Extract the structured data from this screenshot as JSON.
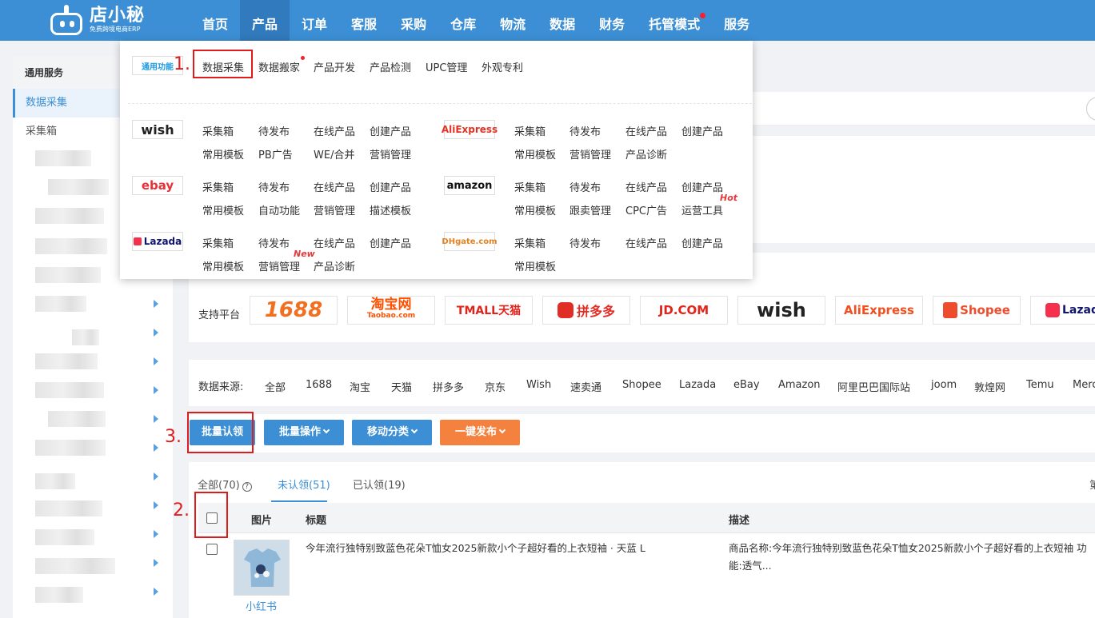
{
  "topbar": {
    "logo_title": "店小秘",
    "logo_sub": "免费跨境电商ERP",
    "nav": [
      "首页",
      "产品",
      "订单",
      "客服",
      "采购",
      "仓库",
      "物流",
      "数据",
      "财务",
      "托管模式",
      "服务"
    ]
  },
  "sidebar": {
    "section_title": "通用服务",
    "items": [
      "数据采集",
      "采集箱"
    ]
  },
  "dropdown": {
    "general_logo": "通用功能",
    "general_links": [
      "数据采集",
      "数据搬家",
      "产品开发",
      "产品检测",
      "UPC管理",
      "外观专利"
    ],
    "platforms": [
      {
        "logo": "wish",
        "links": [
          "采集箱",
          "待发布",
          "在线产品",
          "创建产品",
          "常用模板",
          "PB广告",
          "WE/合并",
          "营销管理"
        ]
      },
      {
        "logo": "AliExpress",
        "links": [
          "采集箱",
          "待发布",
          "在线产品",
          "创建产品",
          "常用模板",
          "营销管理",
          "产品诊断"
        ]
      },
      {
        "logo": "ebay",
        "links": [
          "采集箱",
          "待发布",
          "在线产品",
          "创建产品",
          "常用模板",
          "自动功能",
          "营销管理",
          "描述模板"
        ]
      },
      {
        "logo": "amazon",
        "links": [
          "采集箱",
          "待发布",
          "在线产品",
          "创建产品",
          "常用模板",
          "跟卖管理",
          "CPC广告",
          "运营工具"
        ]
      },
      {
        "logo": "Lazada",
        "links": [
          "采集箱",
          "待发布",
          "在线产品",
          "创建产品",
          "常用模板",
          "营销管理",
          "产品诊断"
        ]
      },
      {
        "logo": "DHgate.com",
        "links": [
          "采集箱",
          "待发布",
          "在线产品",
          "创建产品",
          "常用模板"
        ]
      }
    ],
    "tag_hot": "Hot",
    "tag_new": "New"
  },
  "platforms_row": {
    "label": "支持平台",
    "items": [
      "1688",
      "淘宝网",
      "TMALL天猫",
      "拼多多",
      "JD.COM",
      "wish",
      "AliExpress",
      "Shopee",
      "Lazada"
    ],
    "taobao_sub": "Taobao.com"
  },
  "sources": {
    "label": "数据来源:",
    "items": [
      "全部",
      "1688",
      "淘宝",
      "天猫",
      "拼多多",
      "京东",
      "Wish",
      "速卖通",
      "Shopee",
      "Lazada",
      "eBay",
      "Amazon",
      "阿里巴巴国际站",
      "joom",
      "敦煌网",
      "Temu",
      "Merc"
    ]
  },
  "buttons": {
    "claim": "批量认领",
    "batch": "批量操作",
    "move": "移动分类",
    "publish": "一键发布"
  },
  "tabs": {
    "all": "全部(70)",
    "unclaimed": "未认领(51)",
    "claimed": "已认领(19)",
    "edge": "第"
  },
  "table": {
    "headers": {
      "image": "图片",
      "title": "标题",
      "desc": "描述"
    },
    "row": {
      "title": "今年流行独特别致蓝色花朵T恤女2025新款小个子超好看的上衣短袖 · 天蓝 L",
      "desc": "商品名称:今年流行独特别致蓝色花朵T恤女2025新款小个子超好看的上衣短袖 功能:透气...",
      "source": "小红书"
    }
  },
  "annotations": [
    "1.",
    "2.",
    "3."
  ],
  "colors": {
    "brand": "#3c8fd5",
    "orange": "#f5813f",
    "red": "#e01b1b"
  }
}
